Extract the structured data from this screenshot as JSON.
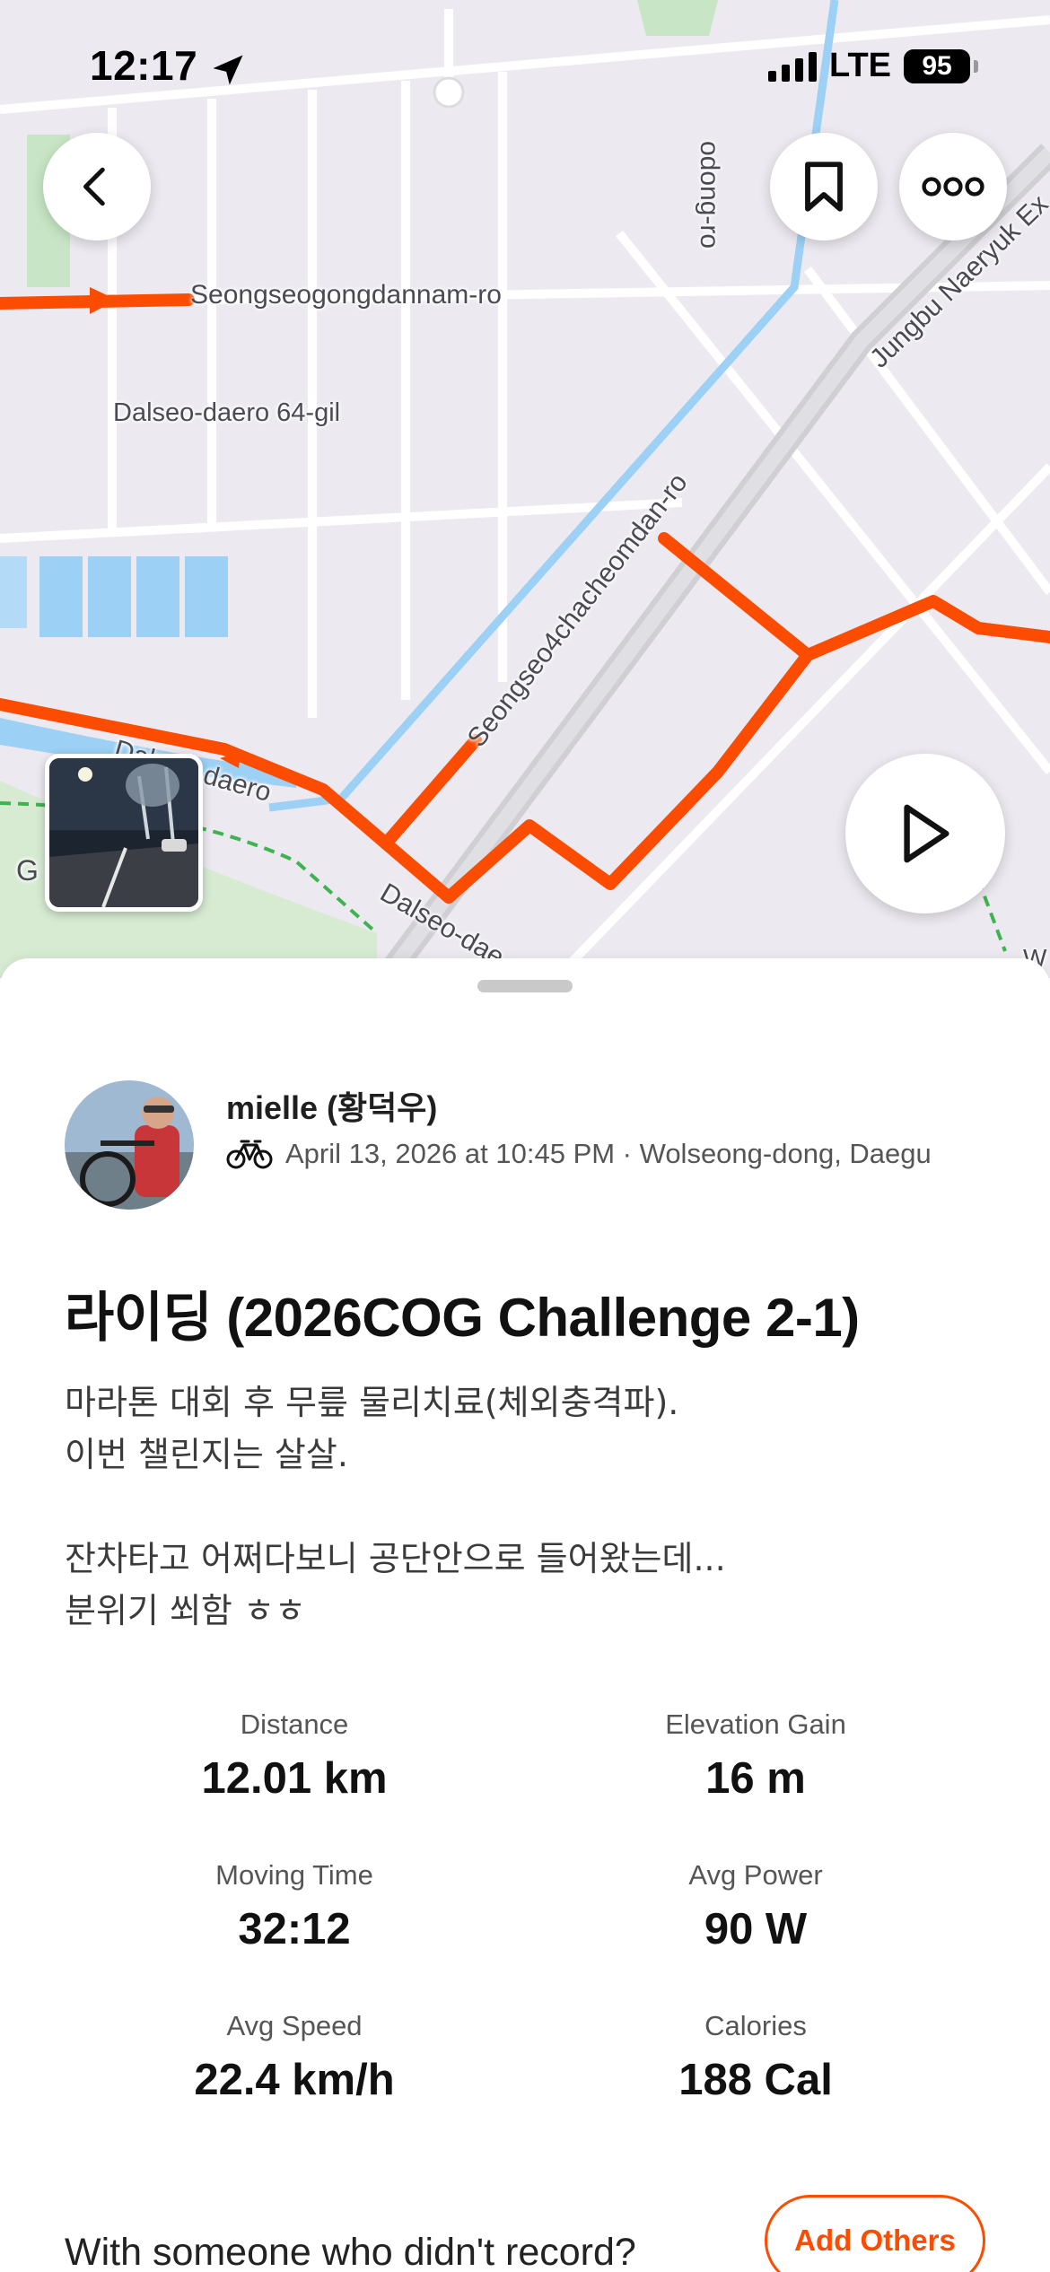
{
  "status_bar": {
    "time": "12:17",
    "network": "LTE",
    "battery": "95",
    "icons": [
      "location-arrow-icon",
      "signal-icon",
      "battery-icon"
    ]
  },
  "map": {
    "route_color": "#fc4c02",
    "street_labels": [
      "Seongseogongdannam-ro",
      "Dalseo-daero 64-gil",
      "Seongseo4chacheomdan-ro",
      "Jungbu Naeryuk Ex",
      "Dalseo-daero",
      "Dalseo-dae",
      "odong-ro",
      "G",
      "W"
    ],
    "buttons": [
      "back-icon",
      "bookmark-icon",
      "more-icon",
      "play-icon"
    ]
  },
  "activity": {
    "user_name": "mielle (황덕우)",
    "activity_icon": "bike-icon",
    "meta": "April 13, 2026 at 10:45 PM · Wolseong-dong, Daegu",
    "title": "라이딩 (2026COG Challenge 2-1)",
    "description": [
      "마라톤 대회 후 무릎 물리치료(체외충격파).",
      "이번 챌린지는 살살.",
      "",
      "잔차타고 어쩌다보니 공단안으로 들어왔는데...",
      "분위기 쐬함 ㅎㅎ"
    ]
  },
  "stats": [
    {
      "label": "Distance",
      "value": "12.01 km"
    },
    {
      "label": "Elevation Gain",
      "value": "16 m"
    },
    {
      "label": "Moving Time",
      "value": "32:12"
    },
    {
      "label": "Avg Power",
      "value": "90 W"
    },
    {
      "label": "Avg Speed",
      "value": "22.4 km/h"
    },
    {
      "label": "Calories",
      "value": "188 Cal"
    }
  ],
  "footer": {
    "prompt": "With someone who didn't record?",
    "add_others_label": "Add Others"
  },
  "colors": {
    "accent": "#fc4c02",
    "water": "#9cd0f5",
    "park": "#c8e6c5"
  }
}
